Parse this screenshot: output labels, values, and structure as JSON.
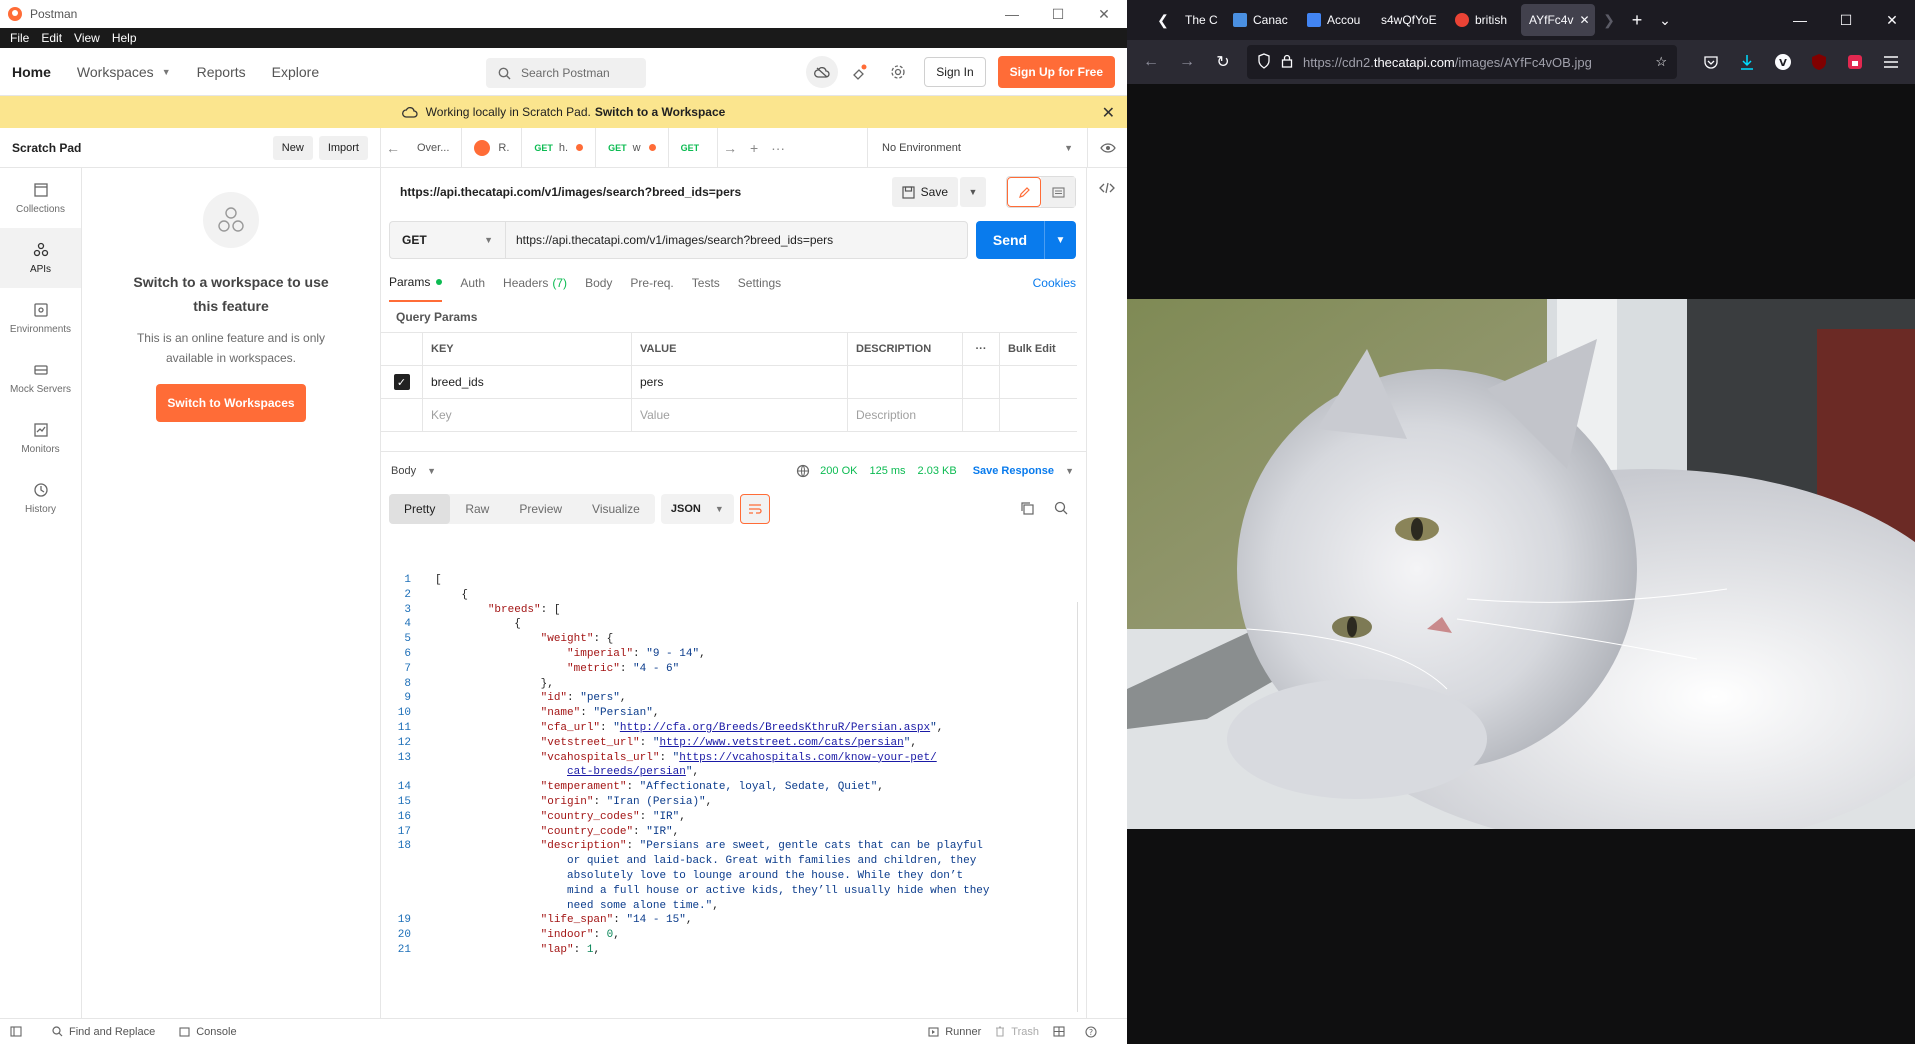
{
  "postman": {
    "title": "Postman",
    "menu": [
      "File",
      "Edit",
      "View",
      "Help"
    ],
    "nav": {
      "home": "Home",
      "workspaces": "Workspaces",
      "reports": "Reports",
      "explore": "Explore"
    },
    "search_placeholder": "Search Postman",
    "sign_in": "Sign In",
    "sign_up": "Sign Up for Free",
    "banner": {
      "text": "Working locally in Scratch Pad.",
      "link": "Switch to a Workspace"
    },
    "scratch": {
      "title": "Scratch Pad",
      "new": "New",
      "import": "Import"
    },
    "rail": [
      {
        "label": "Collections",
        "icon": "collections-icon"
      },
      {
        "label": "APIs",
        "icon": "apis-icon"
      },
      {
        "label": "Environments",
        "icon": "environments-icon"
      },
      {
        "label": "Mock Servers",
        "icon": "mock-servers-icon"
      },
      {
        "label": "Monitors",
        "icon": "monitors-icon"
      },
      {
        "label": "History",
        "icon": "history-icon"
      }
    ],
    "panel": {
      "title": "Switch to a workspace to use this feature",
      "text": "This is an online feature and is only available in workspaces.",
      "button": "Switch to Workspaces"
    },
    "tabs": [
      {
        "label": "Over...",
        "method": ""
      },
      {
        "label": "R.",
        "method": ""
      },
      {
        "label": "h.",
        "method": "GET"
      },
      {
        "label": "w",
        "method": "GET"
      },
      {
        "label": "",
        "method": "GET"
      }
    ],
    "environment": "No Environment",
    "request": {
      "name": "https://api.thecatapi.com/v1/images/search?breed_ids=pers",
      "save": "Save",
      "method": "GET",
      "url": "https://api.thecatapi.com/v1/images/search?breed_ids=pers",
      "send": "Send"
    },
    "req_tabs": {
      "params": "Params",
      "auth": "Auth",
      "headers": "Headers",
      "headers_count": "(7)",
      "body": "Body",
      "prereq": "Pre-req.",
      "tests": "Tests",
      "settings": "Settings",
      "cookies": "Cookies"
    },
    "query_params": {
      "title": "Query Params",
      "headers": {
        "key": "KEY",
        "value": "VALUE",
        "description": "DESCRIPTION",
        "bulk": "Bulk Edit"
      },
      "rows": [
        {
          "key": "breed_ids",
          "value": "pers",
          "description": ""
        }
      ],
      "placeholder": {
        "key": "Key",
        "value": "Value",
        "description": "Description"
      }
    },
    "response": {
      "label": "Body",
      "status": "200 OK",
      "time": "125 ms",
      "size": "2.03 KB",
      "save": "Save Response",
      "views": [
        "Pretty",
        "Raw",
        "Preview",
        "Visualize"
      ],
      "format": "JSON"
    },
    "status_bar": {
      "find": "Find and Replace",
      "console": "Console",
      "runner": "Runner",
      "trash": "Trash"
    }
  },
  "firefox": {
    "tabs": [
      {
        "label": "The C",
        "fav": "#3b3b3b"
      },
      {
        "label": "Canac",
        "fav": "#4a90e2"
      },
      {
        "label": "Accou",
        "fav": "#4285f4"
      },
      {
        "label": "s4wQfYoE",
        "fav": ""
      },
      {
        "label": "british",
        "fav": "#ea4335"
      },
      {
        "label": "AYfFc4v",
        "fav": ""
      }
    ],
    "url_prefix": "https://cdn2.",
    "url_domain": "thecatapi.com",
    "url_path": "/images/AYfFc4vOB.jpg"
  }
}
